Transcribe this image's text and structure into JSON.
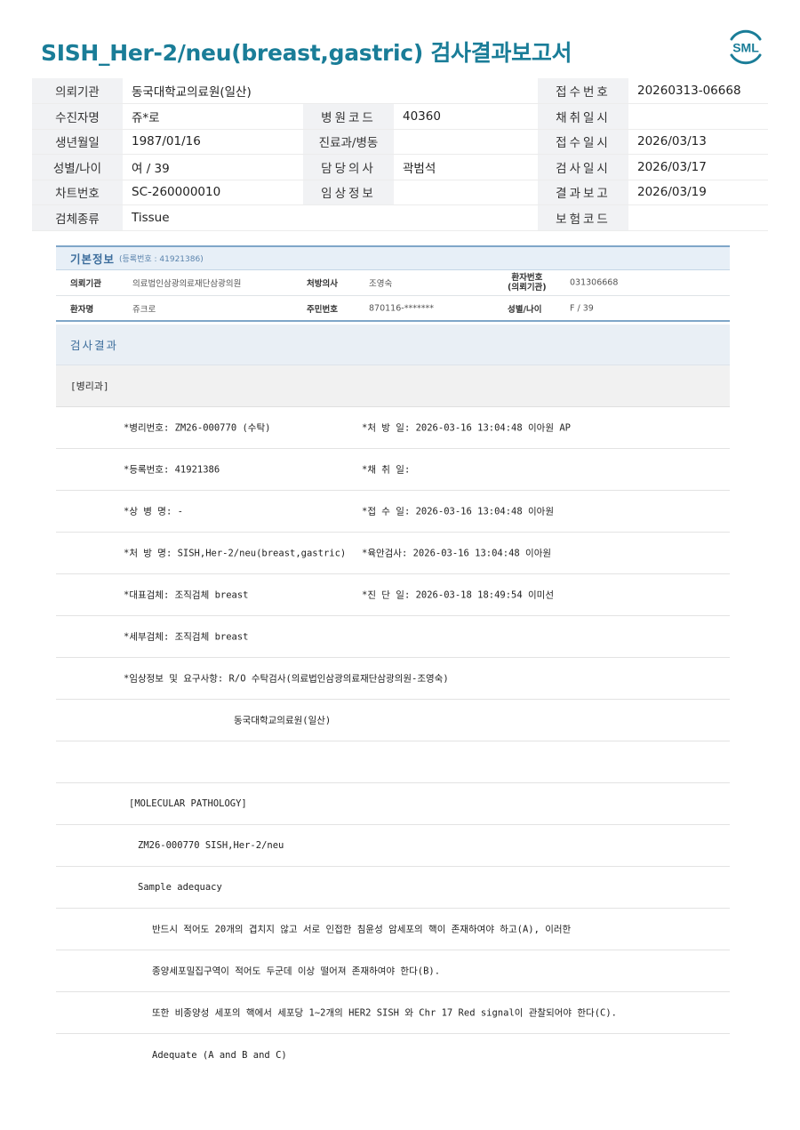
{
  "report_title": "SISH_Her-2/neu(breast,gastric) 검사결과보고서",
  "logo_text": "SML",
  "header": {
    "rows": [
      [
        {
          "label": "의뢰기관",
          "value": "동국대학교의료원(일산)"
        },
        {
          "label": "",
          "value": ""
        },
        {
          "label": "접수번호",
          "value": "20260313-06668"
        }
      ],
      [
        {
          "label": "수진자명",
          "value": "쥬*로"
        },
        {
          "label": "병원코드",
          "value": "40360"
        },
        {
          "label": "채취일시",
          "value": ""
        }
      ],
      [
        {
          "label": "생년월일",
          "value": "1987/01/16"
        },
        {
          "label": "진료과/병동",
          "value": ""
        },
        {
          "label": "접수일시",
          "value": "2026/03/13"
        }
      ],
      [
        {
          "label": "성별/나이",
          "value": "여 / 39"
        },
        {
          "label": "담당의사",
          "value": "곽범석"
        },
        {
          "label": "검사일시",
          "value": "2026/03/17"
        }
      ],
      [
        {
          "label": "차트번호",
          "value": "SC-260000010"
        },
        {
          "label": "임상정보",
          "value": ""
        },
        {
          "label": "결과보고",
          "value": "2026/03/19"
        }
      ],
      [
        {
          "label": "검체종류",
          "value": "Tissue"
        },
        {
          "label": "",
          "value": ""
        },
        {
          "label": "보험코드",
          "value": ""
        }
      ]
    ]
  },
  "basic_info": {
    "title": "기본정보",
    "subtitle": "(등록번호 : 41921386)",
    "row1": {
      "l1": "의뢰기관",
      "v1": "의료법인삼광의료재단삼광의원",
      "l2": "처방의사",
      "v2": "조영숙",
      "l3a": "환자번호",
      "l3b": "(의뢰기관)",
      "v3": "031306668"
    },
    "row2": {
      "l1": "환자명",
      "v1": "쥬크로",
      "l2": "주민번호",
      "v2": "870116-*******",
      "l3": "성별/나이",
      "v3": "F / 39"
    }
  },
  "result": {
    "header": "검사결과",
    "dept": "[병리과]",
    "lines": [
      {
        "a": "*병리번호: ZM26-000770 (수탁)",
        "b": "*처 방 일: 2026-03-16 13:04:48  이아원 AP"
      },
      {
        "a": "*등록번호: 41921386",
        "b": "*채 취 일:"
      },
      {
        "a": "*상 병 명: -",
        "b": "*접 수 일: 2026-03-16 13:04:48  이아원"
      },
      {
        "a": "*처 방 명: SISH,Her-2/neu(breast,gastric)",
        "b": "*육안검사: 2026-03-16 13:04:48  이아원"
      },
      {
        "a": "*대표검체: 조직검체 breast",
        "b": "*진 단 일: 2026-03-18 18:49:54  이미선"
      },
      {
        "a": "*세부검체: 조직검체 breast",
        "b": ""
      },
      {
        "a": "*임상정보 및 요구사항: R/O 수탁검사(의료법인삼광의료재단삼광의원-조영숙)",
        "b": ""
      },
      {
        "a": "동국대학교의료원(일산)",
        "b": ""
      },
      {
        "a": "",
        "b": ""
      },
      {
        "a": "[MOLECULAR PATHOLOGY]",
        "b": ""
      },
      {
        "a": "ZM26-000770     SISH,Her-2/neu",
        "b": ""
      },
      {
        "a": "Sample adequacy",
        "b": ""
      },
      {
        "a": "반드시 적어도 20개의 겹치지 않고 서로 인접한 침윤성 암세포의 핵이 존재하여야 하고(A), 이러한",
        "b": ""
      },
      {
        "a": "종양세포밀집구역이 적어도 두군데 이상 떨어져 존재하여야 한다(B).",
        "b": ""
      },
      {
        "a": "또한 비종양성 세포의 핵에서 세포당 1~2개의 HER2 SISH 와 Chr 17 Red signal이 관찰되어야 한다(C).",
        "b": ""
      },
      {
        "a": "Adequate (A and B and C)",
        "b": ""
      }
    ]
  }
}
